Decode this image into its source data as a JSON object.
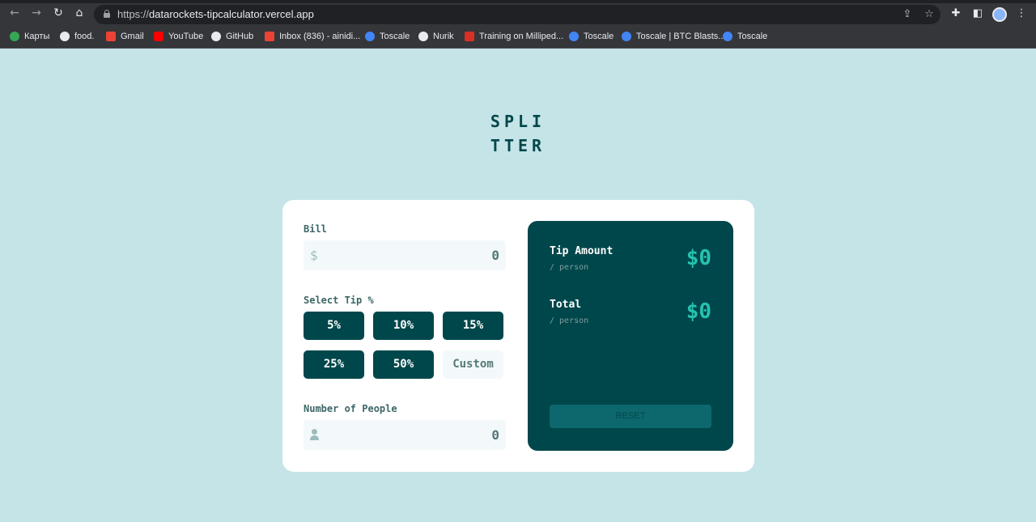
{
  "browser": {
    "url_scheme": "https://",
    "url_host": "datarockets-tipcalculator.vercel.app",
    "bookmarks": [
      {
        "label": "Карты",
        "color": "#34a853"
      },
      {
        "label": "food.",
        "color": "#e8eaed"
      },
      {
        "label": "Gmail",
        "color": "#ea4335"
      },
      {
        "label": "YouTube",
        "color": "#ff0000"
      },
      {
        "label": "GitHub",
        "color": "#e8eaed"
      },
      {
        "label": "Inbox (836) - ainidi...",
        "color": "#ea4335"
      },
      {
        "label": "Toscale",
        "color": "#4285f4"
      },
      {
        "label": "Nurik",
        "color": "#e8eaed"
      },
      {
        "label": "Training on Milliped...",
        "color": "#d93025"
      },
      {
        "label": "Toscale",
        "color": "#4285f4"
      },
      {
        "label": "Toscale | BTC Blasts...",
        "color": "#4285f4"
      },
      {
        "label": "Toscale",
        "color": "#4285f4"
      }
    ]
  },
  "app": {
    "logo_line1": "SPLI",
    "logo_line2": "TTER",
    "bill": {
      "label": "Bill",
      "prefix": "$",
      "value": "0"
    },
    "tip": {
      "label": "Select Tip %",
      "options": [
        "5%",
        "10%",
        "15%",
        "25%",
        "50%"
      ],
      "custom_placeholder": "Custom"
    },
    "people": {
      "label": "Number of People",
      "value": "0"
    },
    "results": {
      "tip_amount_label": "Tip Amount",
      "tip_amount_sub": "/ person",
      "tip_amount_value": "$0",
      "total_label": "Total",
      "total_sub": "/ person",
      "total_value": "$0",
      "reset_label": "RESET"
    },
    "colors": {
      "background": "#c5e4e7",
      "dark_cyan": "#00474b",
      "accent": "#26c2ae"
    }
  }
}
